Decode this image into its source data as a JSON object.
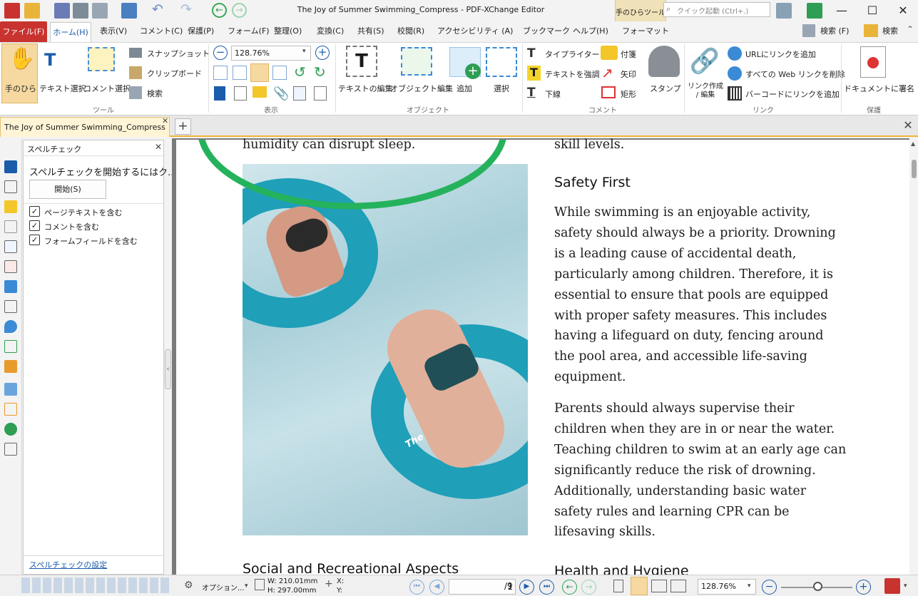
{
  "window": {
    "title": "The Joy of Summer Swimming_Compress - PDF-XChange Editor",
    "context_tab": "手のひらツール",
    "quick_launch_placeholder": "クイック起動 (Ctrl+.)"
  },
  "menu": {
    "file": "ファイル(F)",
    "home": "ホーム(H)",
    "items": [
      "表示(V)",
      "コメント(C)",
      "保護(P)",
      "フォーム(F)",
      "整理(O)",
      "変換(C)",
      "共有(S)",
      "校閲(R)",
      "アクセシビリティ (A)",
      "ブックマーク",
      "ヘルプ(H)"
    ],
    "format": "フォーマット",
    "search_f": "検索 (F)",
    "search": "検索"
  },
  "ribbon": {
    "tools": {
      "hand": "手のひら",
      "text_select": "テキスト選択",
      "comment_select": "コメント選択",
      "snapshot": "スナップショット",
      "clipboard": "クリップボード",
      "find": "検索",
      "group": "ツール"
    },
    "view": {
      "zoom": "128.76%",
      "group": "表示"
    },
    "objects": {
      "edit_text": "テキストの編集",
      "edit_object": "オブジェクト編集",
      "add": "追加",
      "select": "選択",
      "group": "オブジェクト"
    },
    "comment": {
      "typewriter": "タイプライター",
      "sticky": "付箋",
      "highlight": "テキストを強調",
      "arrow": "矢印",
      "underline": "下線",
      "rectangle": "矩形",
      "stamp": "スタンプ",
      "group": "コメント"
    },
    "links": {
      "create": "リンク作成 / 編集",
      "add_url": "URLにリンクを追加",
      "remove_web": "すべての Web リンクを削除",
      "add_barcode": "バーコードにリンクを追加",
      "group": "リンク"
    },
    "protect": {
      "sign": "ドキュメントに署名",
      "group": "保護"
    }
  },
  "tabs": {
    "document": "The Joy of Summer Swimming_Compress"
  },
  "spellcheck": {
    "title": "スペルチェック",
    "instruction": "スペルチェックを開始するにはク...",
    "start": "開始(S)",
    "options": [
      {
        "label": "ページテキストを含む",
        "checked": true
      },
      {
        "label": "コメントを含む",
        "checked": true
      },
      {
        "label": "フォームフィールドを含む",
        "checked": true
      }
    ],
    "settings_link": "スペルチェックの設定"
  },
  "document": {
    "prev_left": "humidity can disrupt sleep.",
    "prev_right": "skill levels.",
    "heading_safety": "Safety First",
    "safety_para1": [
      "While swimming is an enjoyable activity,",
      "safety should always be a priority. Drowning",
      "is a leading cause of accidental death,",
      "particularly among children. Therefore, it is",
      "essential to ensure that pools are equipped",
      "with proper safety measures. This includes",
      "having a lifeguard on duty, fencing around",
      "the pool area, and accessible life-saving",
      "equipment."
    ],
    "safety_para2": [
      "Parents should always supervise their",
      "children when they are in or near the water.",
      "Teaching children to swim at an early age can",
      "significantly reduce the risk of drowning.",
      "Additionally, understanding basic water",
      "safety rules and learning CPR can be",
      "lifesaving skills."
    ],
    "heading_social": "Social and Recreational Aspects",
    "heading_health": "Health and Hygiene",
    "photo_tube_text": "The Wave"
  },
  "status": {
    "options": "オプション...",
    "width": "W: 210.01mm",
    "height": "H: 297.00mm",
    "x": "X:",
    "y": "Y:",
    "page": "1",
    "page_total": "/9",
    "zoom": "128.76%"
  },
  "colors": {
    "accent": "#1b5cab",
    "file_tab": "#c8332f",
    "ring": "#25b25c",
    "water": "#b9d7df",
    "tube": "#1f9fb8"
  }
}
